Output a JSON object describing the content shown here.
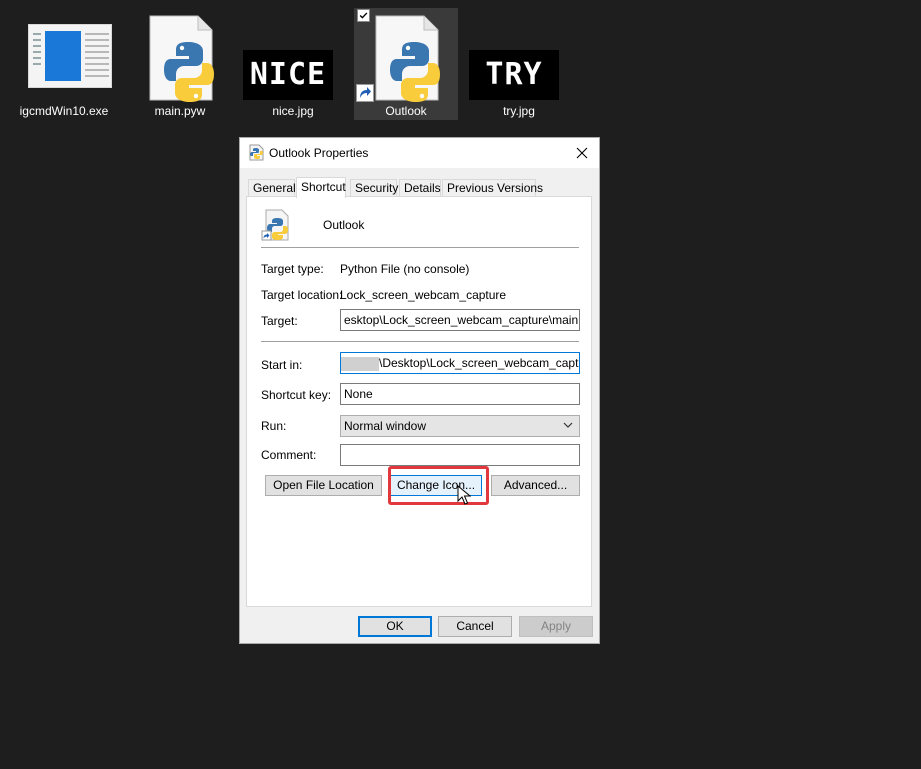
{
  "desktop": {
    "icons": [
      {
        "label": "igcmdWin10.exe",
        "icon": "exe-file-icon"
      },
      {
        "label": "main.pyw",
        "icon": "python-file-icon"
      },
      {
        "label": "nice.jpg",
        "icon": "image-thumbnail-icon",
        "thumb_text": "NICE"
      },
      {
        "label": "Outlook",
        "icon": "python-shortcut-icon",
        "selected": true
      },
      {
        "label": "try.jpg",
        "icon": "image-thumbnail-icon",
        "thumb_text": "TRY"
      }
    ]
  },
  "dialog": {
    "title": "Outlook Properties",
    "tabs": [
      "General",
      "Shortcut",
      "Security",
      "Details",
      "Previous Versions"
    ],
    "active_tab": "Shortcut",
    "shortcut_name": "Outlook",
    "fields": {
      "target_type_label": "Target type:",
      "target_type_value": "Python File (no console)",
      "target_location_label": "Target location:",
      "target_location_value": "Lock_screen_webcam_capture",
      "target_label": "Target:",
      "target_value": "esktop\\Lock_screen_webcam_capture\\main.pyw",
      "start_in_label": "Start in:",
      "start_in_value": "\\Desktop\\Lock_screen_webcam_capture",
      "shortcut_key_label": "Shortcut key:",
      "shortcut_key_value": "None",
      "run_label": "Run:",
      "run_value": "Normal window",
      "comment_label": "Comment:",
      "comment_value": ""
    },
    "buttons": {
      "open_file_location": "Open File Location",
      "change_icon": "Change Icon...",
      "advanced": "Advanced...",
      "ok": "OK",
      "cancel": "Cancel",
      "apply": "Apply"
    }
  },
  "colors": {
    "desktop_bg": "#1e1e1e",
    "highlight_box": "#e0383d",
    "accent": "#0078d7"
  }
}
